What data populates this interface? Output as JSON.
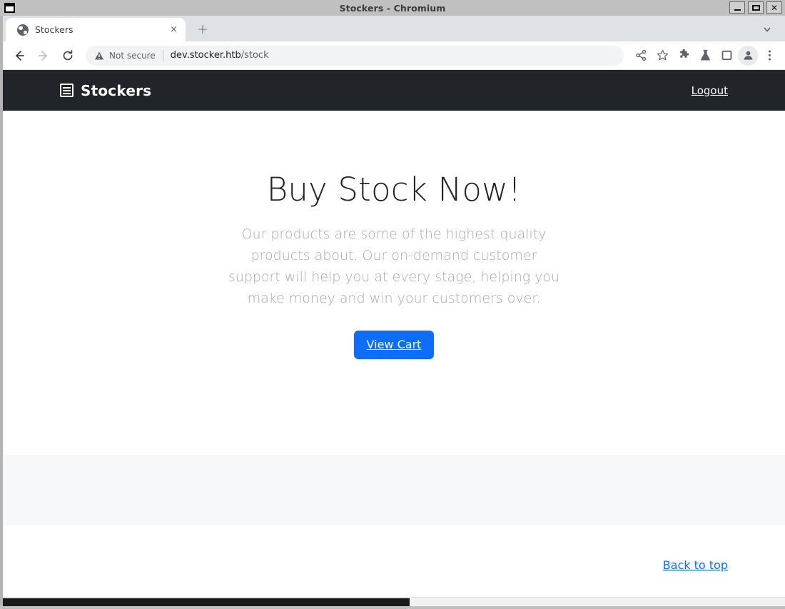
{
  "window": {
    "title": "Stockers - Chromium",
    "controls": {
      "minimize": "minimize-button",
      "maximize": "maximize-button",
      "close": "close-button"
    }
  },
  "browser": {
    "tab": {
      "title": "Stockers",
      "favicon": "globe-icon",
      "close_label": "×"
    },
    "new_tab_label": "+",
    "tab_list_label": "⌄",
    "nav": {
      "back": "back-arrow-icon",
      "forward": "forward-arrow-icon",
      "reload": "reload-icon"
    },
    "omnibox": {
      "security_label": "Not secure",
      "url_host": "dev.stocker.htb",
      "url_path": "/stock",
      "full_url": "dev.stocker.htb/stock"
    },
    "toolbar_icons": [
      "share-icon",
      "star-bookmark-icon",
      "extensions-puzzle-icon",
      "experiments-flask-icon",
      "side-panel-icon",
      "profile-avatar-icon",
      "three-dot-menu-icon"
    ]
  },
  "site": {
    "navbar": {
      "brand": "Stockers",
      "brand_icon": "list-document-icon",
      "logout": "Logout",
      "background": "#212529"
    },
    "hero": {
      "heading": "Buy Stock Now!",
      "paragraph": "Our products are some of the highest quality products about. Our on-demand customer support will help you at every stage, helping you make money and win your customers over.",
      "cta_label": "View Cart",
      "cta_color": "#0d6efd"
    },
    "band": {
      "background": "#f6f8fa"
    },
    "footer": {
      "back_to_top": "Back to top",
      "link_color": "#0d6efd"
    }
  }
}
